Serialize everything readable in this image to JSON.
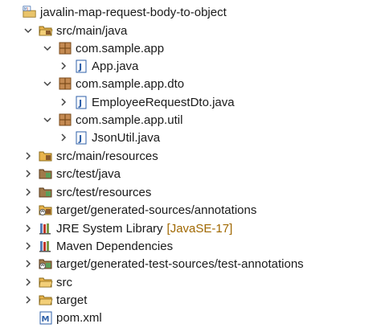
{
  "tree": {
    "project": {
      "label": "javalin-map-request-body-to-object"
    },
    "src_main_java": {
      "label": "src/main/java"
    },
    "pkg_app": {
      "label": "com.sample.app"
    },
    "file_app": {
      "label": "App.java"
    },
    "pkg_dto": {
      "label": "com.sample.app.dto"
    },
    "file_dto": {
      "label": "EmployeeRequestDto.java"
    },
    "pkg_util": {
      "label": "com.sample.app.util"
    },
    "file_util": {
      "label": "JsonUtil.java"
    },
    "src_main_resources": {
      "label": "src/main/resources"
    },
    "src_test_java": {
      "label": "src/test/java"
    },
    "src_test_resources": {
      "label": "src/test/resources"
    },
    "gen_sources": {
      "label": "target/generated-sources/annotations"
    },
    "jre": {
      "label": "JRE System Library",
      "decoration": "[JavaSE-17]"
    },
    "maven": {
      "label": "Maven Dependencies"
    },
    "gen_test_sources": {
      "label": "target/generated-test-sources/test-annotations"
    },
    "src": {
      "label": "src"
    },
    "target": {
      "label": "target"
    },
    "pom": {
      "label": "pom.xml"
    }
  },
  "colors": {
    "decoration": "#a06800",
    "folder": "#e9b44c",
    "package": "#8a5a2b",
    "java_file": "#2d5fa8"
  }
}
